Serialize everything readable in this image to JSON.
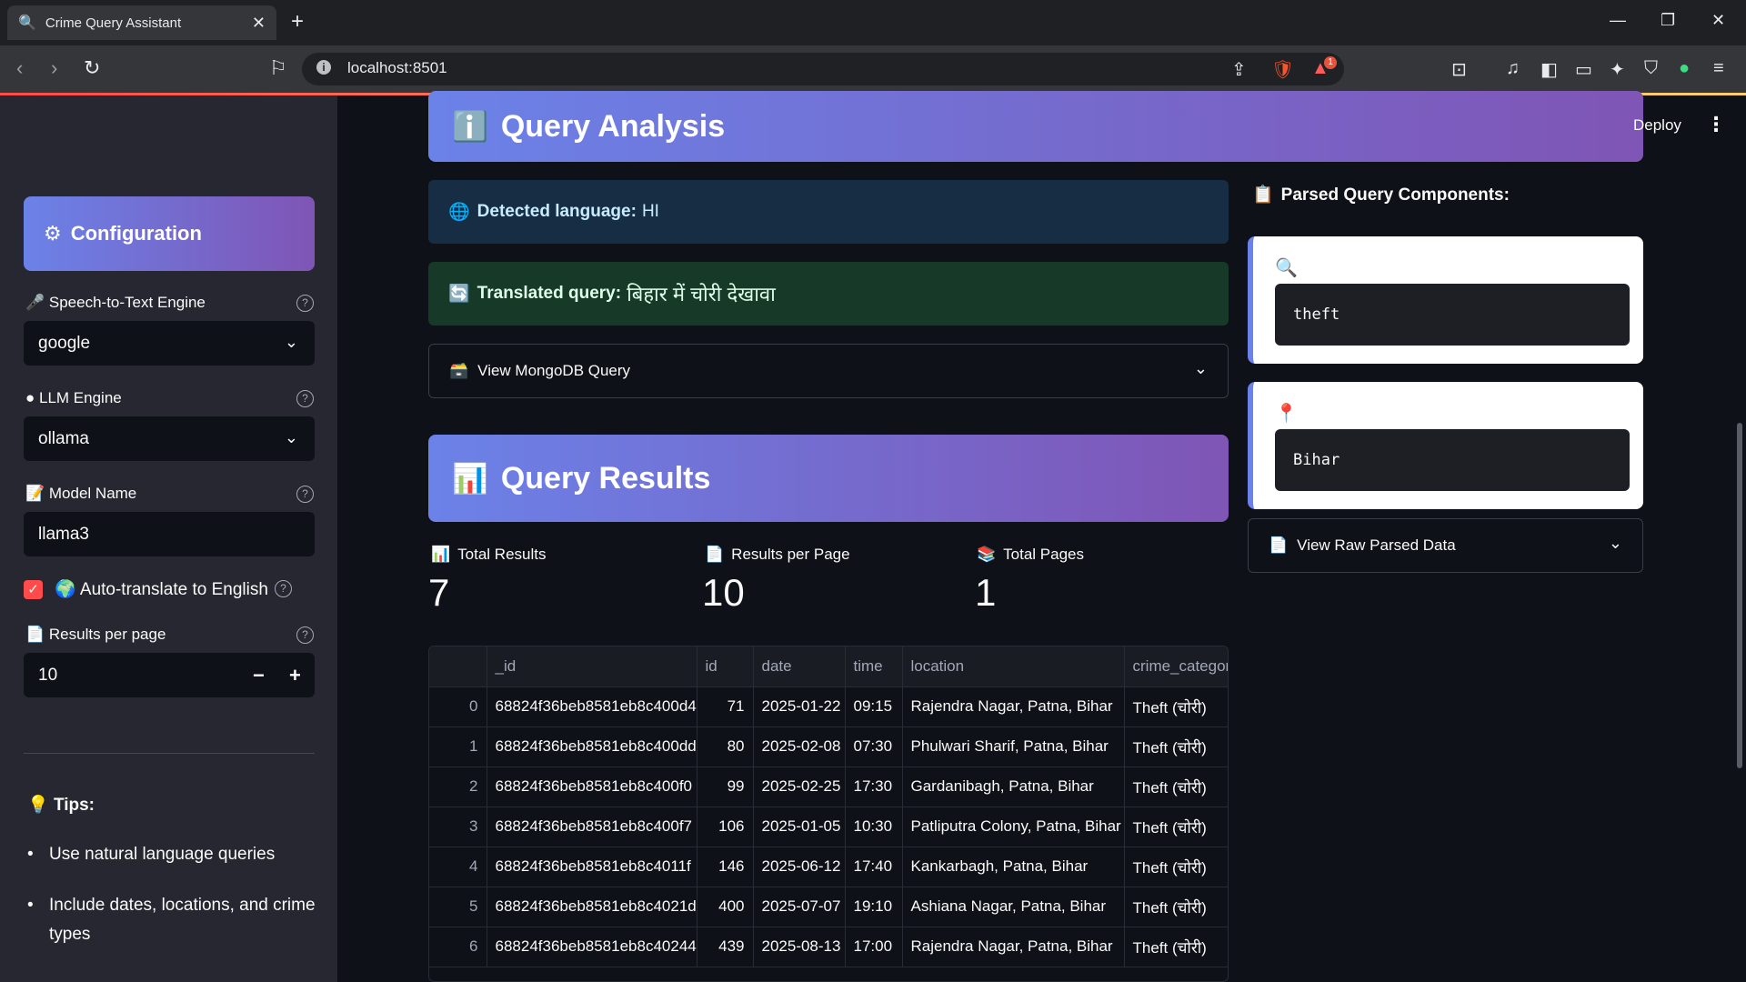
{
  "browser": {
    "tab_title": "Crime Query Assistant",
    "url": "localhost:8501",
    "notification_count": "1"
  },
  "app": {
    "deploy_label": "Deploy"
  },
  "sidebar": {
    "config_title": "Configuration",
    "stt_label": "Speech-to-Text Engine",
    "stt_value": "google",
    "llm_label": "LLM Engine",
    "llm_value": "ollama",
    "model_label": "Model Name",
    "model_value": "llama3",
    "auto_translate_label": "Auto-translate to English",
    "auto_translate_checked": true,
    "results_per_page_label": "Results per page",
    "results_per_page_value": "10",
    "tips_title": "Tips:",
    "tips": [
      "Use natural language queries",
      "Include dates, locations, and crime types"
    ]
  },
  "main": {
    "query_analysis_title": "Query Analysis",
    "detected_language_label": "Detected language:",
    "detected_language_value": "HI",
    "translated_query_label": "Translated query:",
    "translated_query_value": "बिहार में चोरी देखावा",
    "view_mongodb_label": "View MongoDB Query",
    "query_results_title": "Query Results",
    "metrics": {
      "total_results_label": "Total Results",
      "total_results_value": "7",
      "per_page_label": "Results per Page",
      "per_page_value": "10",
      "total_pages_label": "Total Pages",
      "total_pages_value": "1"
    },
    "table": {
      "columns": [
        "",
        "_id",
        "id",
        "date",
        "time",
        "location",
        "crime_categor"
      ],
      "rows": [
        [
          "0",
          "68824f36beb8581eb8c400d4",
          "71",
          "2025-01-22",
          "09:15",
          "Rajendra Nagar, Patna, Bihar",
          "Theft (चोरी)"
        ],
        [
          "1",
          "68824f36beb8581eb8c400dd",
          "80",
          "2025-02-08",
          "07:30",
          "Phulwari Sharif, Patna, Bihar",
          "Theft (चोरी)"
        ],
        [
          "2",
          "68824f36beb8581eb8c400f0",
          "99",
          "2025-02-25",
          "17:30",
          "Gardanibagh, Patna, Bihar",
          "Theft (चोरी)"
        ],
        [
          "3",
          "68824f36beb8581eb8c400f7",
          "106",
          "2025-01-05",
          "10:30",
          "Patliputra Colony, Patna, Bihar",
          "Theft (चोरी)"
        ],
        [
          "4",
          "68824f36beb8581eb8c4011f",
          "146",
          "2025-06-12",
          "17:40",
          "Kankarbagh, Patna, Bihar",
          "Theft (चोरी)"
        ],
        [
          "5",
          "68824f36beb8581eb8c4021d",
          "400",
          "2025-07-07",
          "19:10",
          "Ashiana Nagar, Patna, Bihar",
          "Theft (चोरी)"
        ],
        [
          "6",
          "68824f36beb8581eb8c40244",
          "439",
          "2025-08-13",
          "17:00",
          "Rajendra Nagar, Patna, Bihar",
          "Theft (चोरी)"
        ]
      ]
    },
    "parsed": {
      "title": "Parsed Query Components:",
      "crime_type_value": "theft",
      "location_value": "Bihar",
      "view_raw_label": "View Raw Parsed Data"
    }
  },
  "colors": {
    "accent_red": "#ff4b4b",
    "banner_start": "#6b82e8",
    "banner_end": "#7f55b5",
    "info_bg": "#172d43",
    "success_bg": "#173928"
  }
}
